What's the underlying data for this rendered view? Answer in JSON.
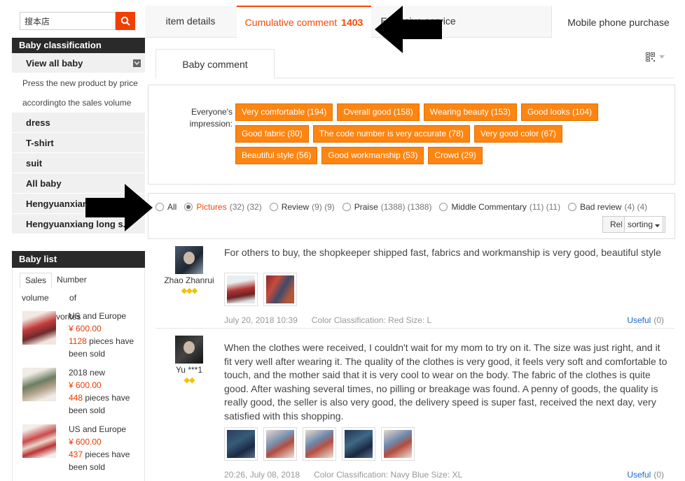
{
  "search": {
    "value": "搜本店",
    "placeholder": ""
  },
  "sidebar": {
    "classification_title": "Baby classification",
    "categories": [
      {
        "label": "View all baby"
      },
      {
        "label": "Press the new product by price"
      },
      {
        "label": "accordingto the sales volume"
      },
      {
        "label": "dress"
      },
      {
        "label": "T-shirt"
      },
      {
        "label": "suit"
      },
      {
        "label": "All baby"
      },
      {
        "label": "Hengyuanxiang"
      },
      {
        "label": "Hengyuanxiang long s..."
      }
    ],
    "list_title": "Baby list",
    "list_tabs": [
      "Sales",
      "Number"
    ],
    "list_subtabs": [
      "volume",
      "of",
      "favorites"
    ],
    "products": [
      {
        "name": "US and Europe",
        "price": "¥ 600.00",
        "sold_count": "1128",
        "sold_text": " pieces have been sold"
      },
      {
        "name": "2018 new",
        "price": "¥ 600.00",
        "sold_count": "448",
        "sold_text": " pieces have been sold"
      },
      {
        "name": "US and Europe",
        "price": "¥ 600.00",
        "sold_count": "437",
        "sold_text": " pieces have been sold"
      }
    ]
  },
  "tabs": {
    "item_details": "item details",
    "cumulative_label": "Cumulative comment",
    "cumulative_count": "1403",
    "specialty_service": "Exclusive service",
    "mobile": "Mobile phone purchase"
  },
  "subtab": {
    "label": "Baby comment"
  },
  "impression": {
    "label_line1": "Everyone's",
    "label_line2": "impression:",
    "tags": [
      [
        "Very comfortable (194)",
        "Overall good (158)",
        "Wearing beauty (153)",
        "Good looks (104)"
      ],
      [
        "Good fabric (80)",
        "The code number is very accurate (78)",
        "Very good color (67)"
      ],
      [
        "Beautiful style (56)",
        "Good workmanship (53)",
        "Crowd (29)"
      ]
    ]
  },
  "filters": [
    {
      "label": "All",
      "count": "",
      "selected": false,
      "active": false
    },
    {
      "label": "Pictures",
      "count": "(32) (32)",
      "selected": true,
      "active": true
    },
    {
      "label": "Review",
      "count": "(9) (9)",
      "selected": false,
      "active": false
    },
    {
      "label": "Praise",
      "count": "(1388) (1388)",
      "selected": false,
      "active": false
    },
    {
      "label": "Middle Commentary",
      "count": "(11) (11)",
      "selected": false,
      "active": false
    },
    {
      "label": "Bad review",
      "count": "(4) (4)",
      "selected": false,
      "active": false
    }
  ],
  "sort": {
    "relevance_label": "Relevance",
    "sorting_label": "sorting"
  },
  "reviews": [
    {
      "user": "Zhao Zhanrui",
      "gems": "◆◆◆",
      "text": "For others to buy, the shopkeeper shipped fast, fabrics and workmanship is very good, beautiful style",
      "date": "July 20, 2018 10:39",
      "classification": "Color Classification: Red Size: L",
      "useful_label": "Useful",
      "useful_count": "(0)",
      "photo_count": 2
    },
    {
      "user": "Yu ***1",
      "gems": "◆◆",
      "text": "When the clothes were received, I couldn't wait for my mom to try on it. The size was just right, and it fit very well after wearing it. The quality of the clothes is very good, it feels very soft and comfortable to touch, and the mother said that it is very cool to wear on the body. The fabric of the clothes is quite good. After washing several times, no pilling or breakage was found. A penny of goods, the quality is really good, the seller is also very good, the delivery speed is super fast, received the next day, very satisfied with this shopping.",
      "date": "20:26, July 08, 2018",
      "classification": "Color Classification: Navy Blue Size: XL",
      "useful_label": "Useful",
      "useful_count": "(0)",
      "photo_count": 5
    }
  ],
  "colors": {
    "accent": "#ff4400",
    "tag": "#fd8512",
    "dark_header": "#2a2a2a",
    "link": "#1a66cc"
  },
  "icons": {
    "search": "search-icon",
    "qr": "qr-code-icon",
    "chevron": "chevron-down-icon",
    "arrow": "arrow-icon"
  }
}
